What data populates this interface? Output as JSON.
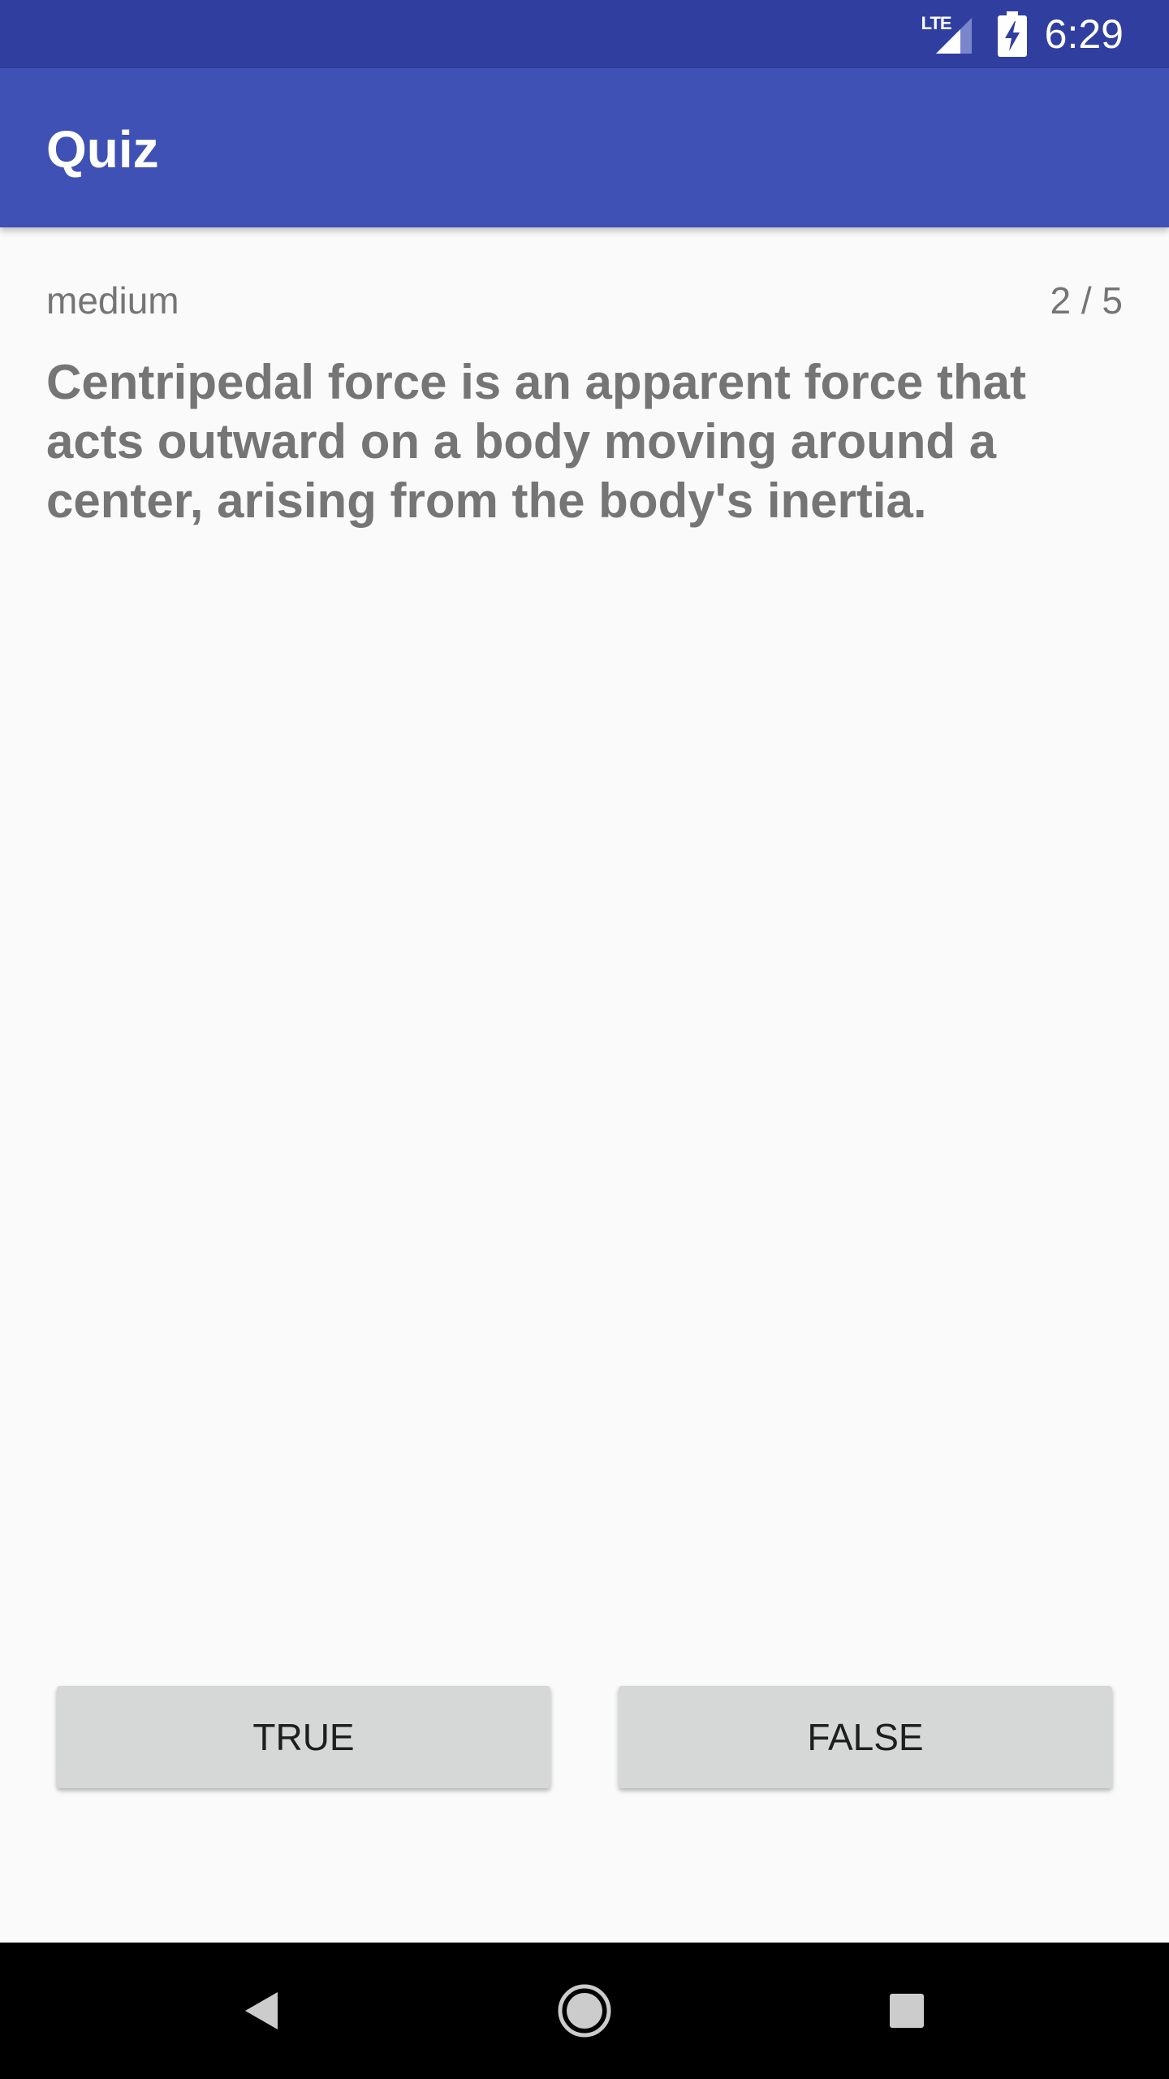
{
  "status_bar": {
    "network_label": "LTE",
    "time": "6:29",
    "icons": [
      "lte-signal-icon",
      "battery-charging-icon"
    ]
  },
  "app_bar": {
    "title": "Quiz"
  },
  "quiz": {
    "difficulty": "medium",
    "progress": "2 / 5",
    "question": "Centripedal force is an apparent force that acts outward on a body moving around a center, arising from the body's inertia."
  },
  "answers": {
    "true_label": "TRUE",
    "false_label": "FALSE"
  },
  "nav_bar": {
    "icons": [
      "back-icon",
      "home-icon",
      "recents-icon"
    ]
  },
  "colors": {
    "primary": "#3f51b5",
    "primary_dark": "#303f9f",
    "background": "#fafafa",
    "text_secondary": "#757575",
    "button": "#d6d7d7"
  }
}
